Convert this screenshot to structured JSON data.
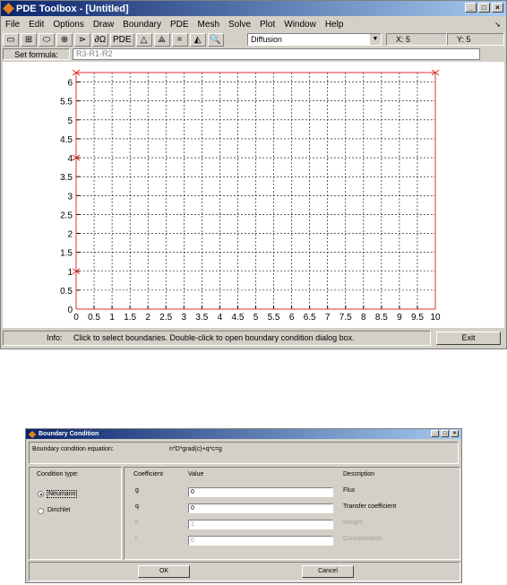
{
  "main_window": {
    "title": "PDE Toolbox - [Untitled]",
    "menu": [
      "File",
      "Edit",
      "Options",
      "Draw",
      "Boundary",
      "PDE",
      "Mesh",
      "Solve",
      "Plot",
      "Window",
      "Help"
    ],
    "toolbar_text": [
      "PDE",
      "="
    ],
    "application_mode": "Diffusion",
    "x_readout": "X: 5",
    "y_readout": "Y: 5",
    "set_formula_label": "Set formula:",
    "set_formula_value": "R3-R1-R2",
    "info_label": "Info:",
    "info_text": "Click to select boundaries. Double-click to open boundary condition dialog box.",
    "exit_label": "Exit"
  },
  "chart_data": {
    "type": "line",
    "xlim": [
      0,
      10
    ],
    "ylim": [
      0,
      6.25
    ],
    "x_ticks": [
      "0",
      "0.5",
      "1",
      "1.5",
      "2",
      "2.5",
      "3",
      "3.5",
      "4",
      "4.5",
      "5",
      "5.5",
      "6",
      "6.5",
      "7",
      "7.5",
      "8",
      "8.5",
      "9",
      "9.5",
      "10"
    ],
    "y_ticks": [
      "0",
      "0.5",
      "1",
      "1.5",
      "2",
      "2.5",
      "3",
      "3.5",
      "4",
      "4.5",
      "5",
      "5.5",
      "6"
    ],
    "grid": true,
    "grid_style": "dashed",
    "boundary_color": "#e03030",
    "boundary": {
      "x": [
        0,
        10,
        10,
        0,
        0
      ],
      "y": [
        0,
        0,
        6.25,
        6.25,
        0
      ]
    },
    "boundary_arrows": [
      {
        "x": 0,
        "y": 1.0
      },
      {
        "x": 0,
        "y": 4.0
      },
      {
        "x": 0,
        "y": 6.25
      },
      {
        "x": 10,
        "y": 6.25
      }
    ]
  },
  "dialog": {
    "title": "Boundary Condition",
    "equation_label": "Boundary condition equation:",
    "equation": "n*D*grad(c)+q*c=g",
    "condition_type_label": "Condition type:",
    "options": [
      "Neumann",
      "Dirichlet"
    ],
    "selected_option": "Neumann",
    "col_coefficient": "Coefficient",
    "col_value": "Value",
    "col_description": "Description",
    "rows": [
      {
        "coef": "g",
        "value": "0",
        "desc": "Flux",
        "enabled": true
      },
      {
        "coef": "q",
        "value": "0",
        "desc": "Transfer coefficient",
        "enabled": true
      },
      {
        "coef": "h",
        "value": "1",
        "desc": "Weight",
        "enabled": false
      },
      {
        "coef": "r",
        "value": "0",
        "desc": "Concentration",
        "enabled": false
      }
    ],
    "ok_label": "OK",
    "cancel_label": "Cancel"
  }
}
